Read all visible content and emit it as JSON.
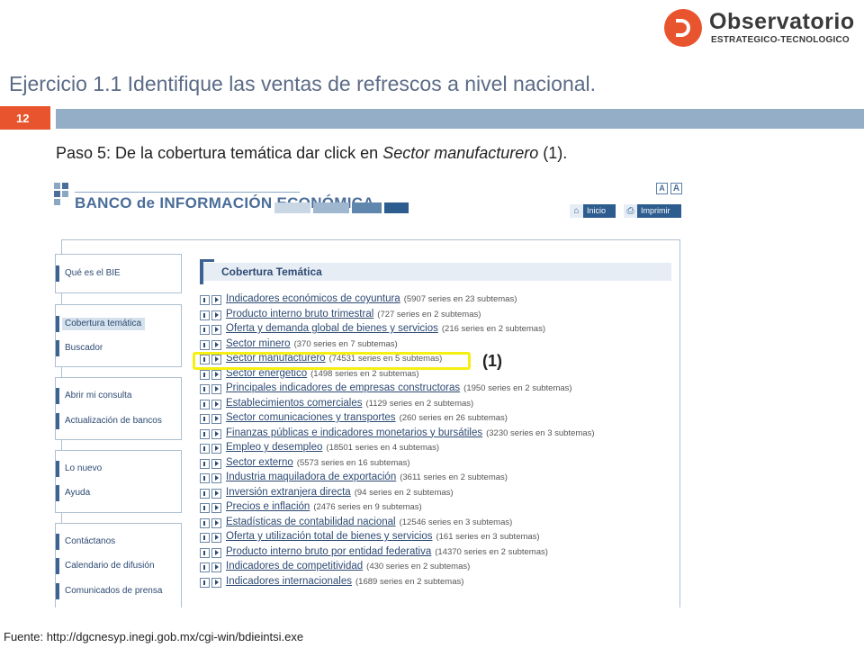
{
  "logo": {
    "name": "Observatorio",
    "subtitle": "ESTRATEGICO-TECNOLOGICO"
  },
  "slide": {
    "title": "Ejercicio 1.1 Identifique las ventas de refrescos a nivel nacional.",
    "page_number": "12",
    "instruction_prefix": "Paso 5: De la cobertura temática dar click en ",
    "instruction_link": "Sector manufacturero",
    "instruction_suffix": " (1).",
    "source": "Fuente: http://dgcnesyp.inegi.gob.mx/cgi-win/bdieintsi.exe"
  },
  "site": {
    "banner": "BANCO de INFORMACIÓN ECONÓMICA",
    "font_small": "A",
    "font_large": "A",
    "btn_home": "Inicio",
    "btn_print": "Imprimir",
    "section_title": "Cobertura Temática",
    "menu": {
      "que_es": "Qué es el BIE",
      "cobertura": "Cobertura temática",
      "buscador": "Buscador",
      "abrir": "Abrir mi consulta",
      "actualizacion": "Actualización de bancos",
      "nuevo": "Lo nuevo",
      "ayuda": "Ayuda",
      "contactanos": "Contáctanos",
      "calendario": "Calendario de difusión",
      "comunicados": "Comunicados de prensa"
    },
    "topics": [
      {
        "label": "Indicadores económicos de coyuntura",
        "count": "(5907 series en 23 subtemas)"
      },
      {
        "label": "Producto interno bruto trimestral",
        "count": "(727 series en 2 subtemas)"
      },
      {
        "label": "Oferta y demanda global de bienes y servicios",
        "count": "(216 series en 2 subtemas)"
      },
      {
        "label": "Sector minero",
        "count": "(370 series en 7 subtemas)"
      },
      {
        "label": "Sector manufacturero",
        "count": "(74531 series en 5 subtemas)"
      },
      {
        "label": "Sector energético",
        "count": "(1498 series en 2 subtemas)"
      },
      {
        "label": "Principales indicadores de empresas constructoras",
        "count": "(1950 series en 2 subtemas)"
      },
      {
        "label": "Establecimientos comerciales",
        "count": "(1129 series en 2 subtemas)"
      },
      {
        "label": "Sector comunicaciones y transportes",
        "count": "(260 series en 26 subtemas)"
      },
      {
        "label": "Finanzas públicas e indicadores monetarios y bursátiles",
        "count": "(3230 series en 3 subtemas)"
      },
      {
        "label": "Empleo y desempleo",
        "count": "(18501 series en 4 subtemas)"
      },
      {
        "label": "Sector externo",
        "count": "(5573 series en 16 subtemas)"
      },
      {
        "label": "Industria maquiladora de exportación",
        "count": "(3611 series en 2 subtemas)"
      },
      {
        "label": "Inversión extranjera directa",
        "count": "(94 series en 2 subtemas)"
      },
      {
        "label": "Precios e inflación",
        "count": "(2476 series en 9 subtemas)"
      },
      {
        "label": "Estadísticas de contabilidad nacional",
        "count": "(12546 series en 3 subtemas)"
      },
      {
        "label": "Oferta y utilización total de bienes y servicios",
        "count": "(161 series en 3 subtemas)"
      },
      {
        "label": "Producto interno bruto por entidad federativa",
        "count": "(14370 series en 2 subtemas)"
      },
      {
        "label": "Indicadores de competitividad",
        "count": "(430 series en 2 subtemas)"
      },
      {
        "label": "Indicadores internacionales",
        "count": "(1689 series en 2 subtemas)"
      }
    ]
  },
  "annotation": {
    "label": "(1)",
    "color": "#f6ef12"
  },
  "colors": {
    "accent": "#e8542d",
    "header_bar": "#95aec8",
    "title": "#5b6b86",
    "link": "#2d4a73"
  }
}
